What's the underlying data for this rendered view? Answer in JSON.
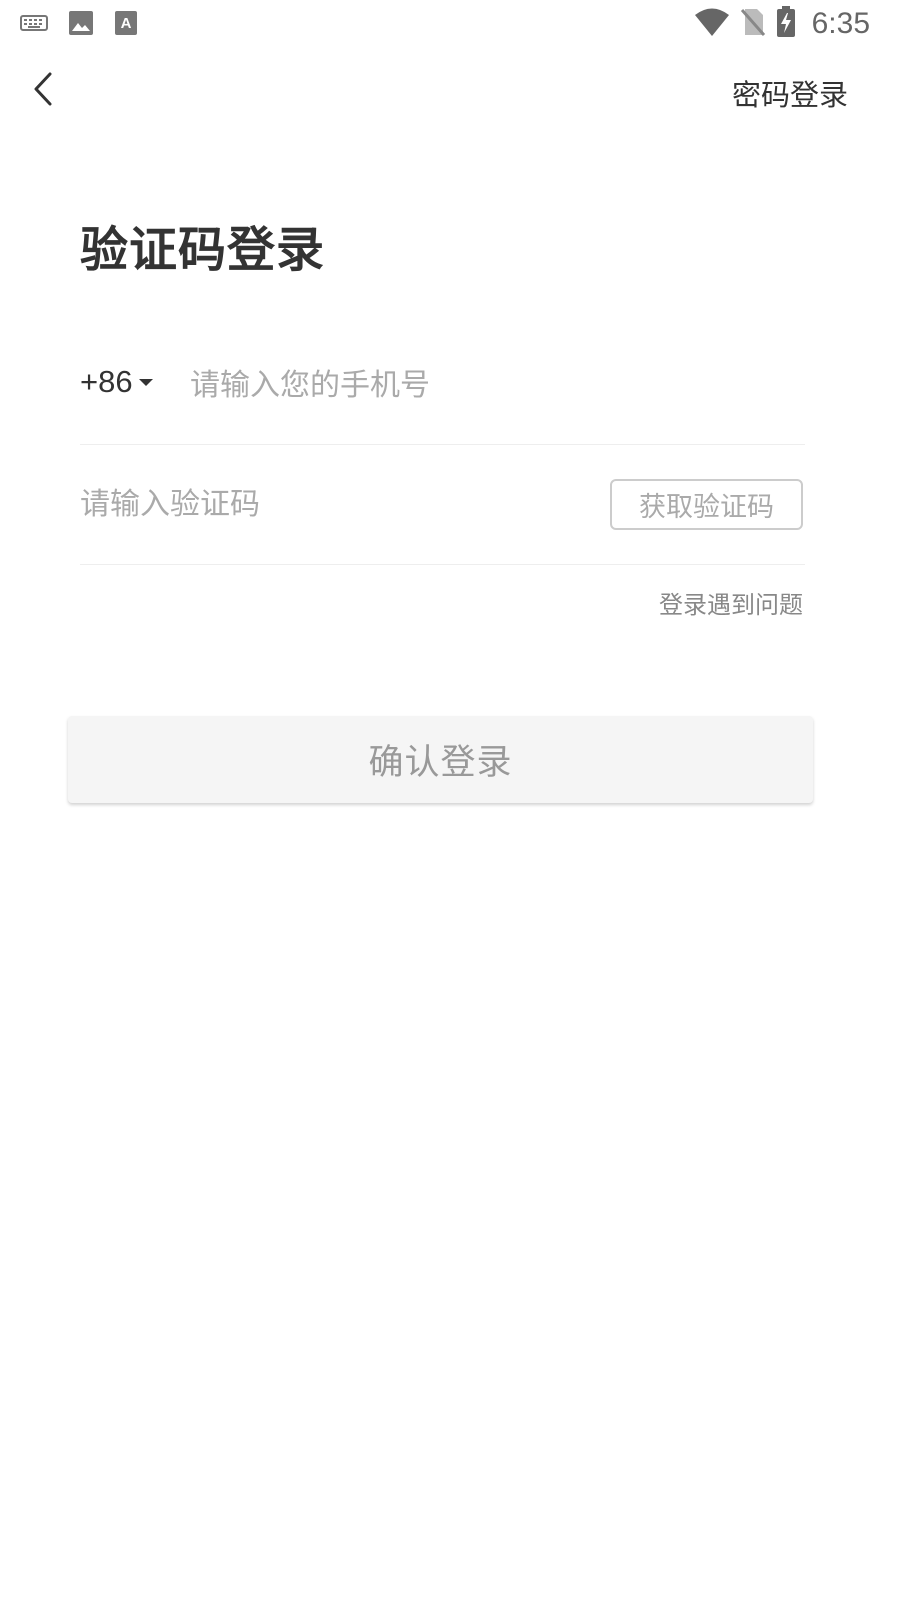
{
  "status_bar": {
    "time": "6:35",
    "left_icons": [
      "keyboard-icon",
      "image-icon",
      "font-download-icon"
    ],
    "right_icons": [
      "wifi-icon",
      "no-sim-icon",
      "battery-charging-icon"
    ]
  },
  "nav": {
    "back_icon": "chevron-left-icon",
    "password_login_label": "密码登录"
  },
  "title": "验证码登录",
  "phone": {
    "country_code": "+86",
    "placeholder": "请输入您的手机号",
    "value": ""
  },
  "code": {
    "placeholder": "请输入验证码",
    "value": "",
    "get_code_label": "获取验证码"
  },
  "help_label": "登录遇到问题",
  "confirm_label": "确认登录",
  "colors": {
    "text_primary": "#333333",
    "placeholder": "#aaaaaa",
    "disabled_text": "#999999",
    "button_bg": "#f5f5f5",
    "divider": "#eeeeee"
  }
}
